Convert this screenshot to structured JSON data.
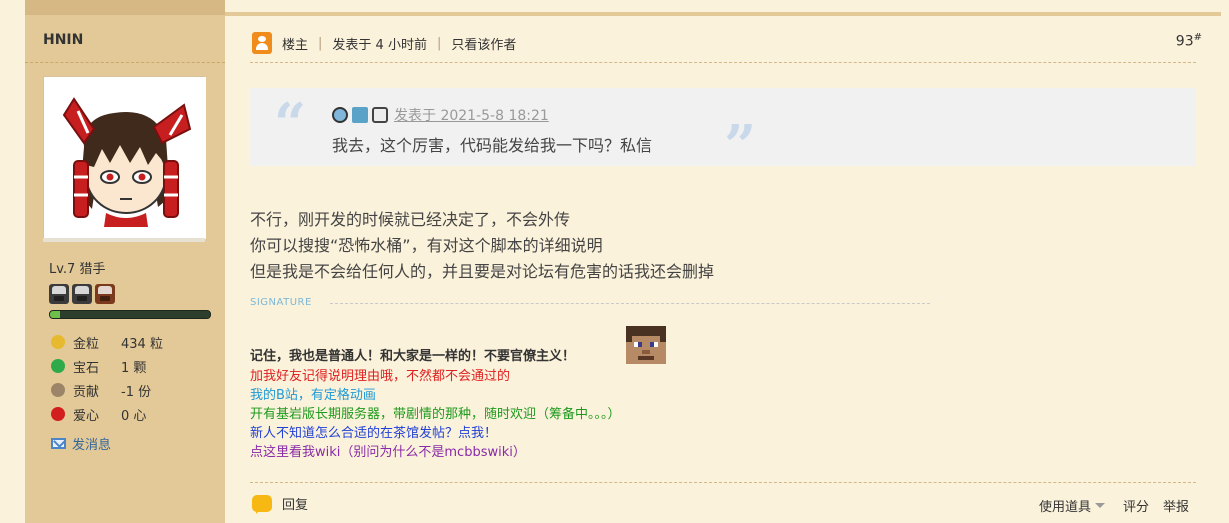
{
  "user": {
    "name": "HNIN",
    "level": "Lv.7 猎手",
    "xp_progress": 0.06,
    "medals": [
      "#3b3b3b",
      "#3b3b3b",
      "#7b3a1c"
    ],
    "stats": [
      {
        "icon": "gold-nugget-icon",
        "label": "金粒",
        "value": "434 粒",
        "color": "#e6b92e"
      },
      {
        "icon": "emerald-icon",
        "label": "宝石",
        "value": "1 颗",
        "color": "#2faa4a"
      },
      {
        "icon": "contribution-icon",
        "label": "贡献",
        "value": "-1 份",
        "color": "#9c8468"
      },
      {
        "icon": "apple-heart-icon",
        "label": "爱心",
        "value": "0 心",
        "color": "#d21e1e"
      }
    ],
    "send_message": "发消息"
  },
  "post": {
    "op_label": "楼主",
    "posted_time": "发表于 4 小时前",
    "only_author": "只看该作者",
    "floor": "93",
    "floor_mark": "#"
  },
  "quote": {
    "date": "发表于 2021-5-8 18:21",
    "text": "我去，这个厉害，代码能发给我一下吗？私信"
  },
  "body": [
    "不行，刚开发的时候就已经决定了，不会外传",
    "你可以搜搜“恐怖水桶”，有对这个脚本的详细说明",
    "但是我是不会给任何人的，并且要是对论坛有危害的话我还会删掉"
  ],
  "signature": {
    "label": "SIGNATURE",
    "bold_line": "记住，我也是普通人！和大家是一样的！不要官僚主义！",
    "lines": [
      {
        "text": "加我好友记得说明理由哦，不然都不会通过的",
        "color": "#e02020"
      },
      {
        "text": "我的B站，有定格动画",
        "color": "#1e9ad6"
      },
      {
        "text": "开有基岩版长期服务器，带剧情的那种，随时欢迎（筹备中。。。）",
        "color": "#1d9a1d"
      },
      {
        "text": "新人不知道怎么合适的在茶馆发帖？点我！",
        "color": "#1f3fd6"
      },
      {
        "text": "点这里看我wiki（别问为什么不是mcbbswiki）",
        "color": "#8a2aa8"
      }
    ]
  },
  "footer": {
    "reply": "回复",
    "use_tool": "使用道具",
    "rate": "评分",
    "report": "举报"
  }
}
